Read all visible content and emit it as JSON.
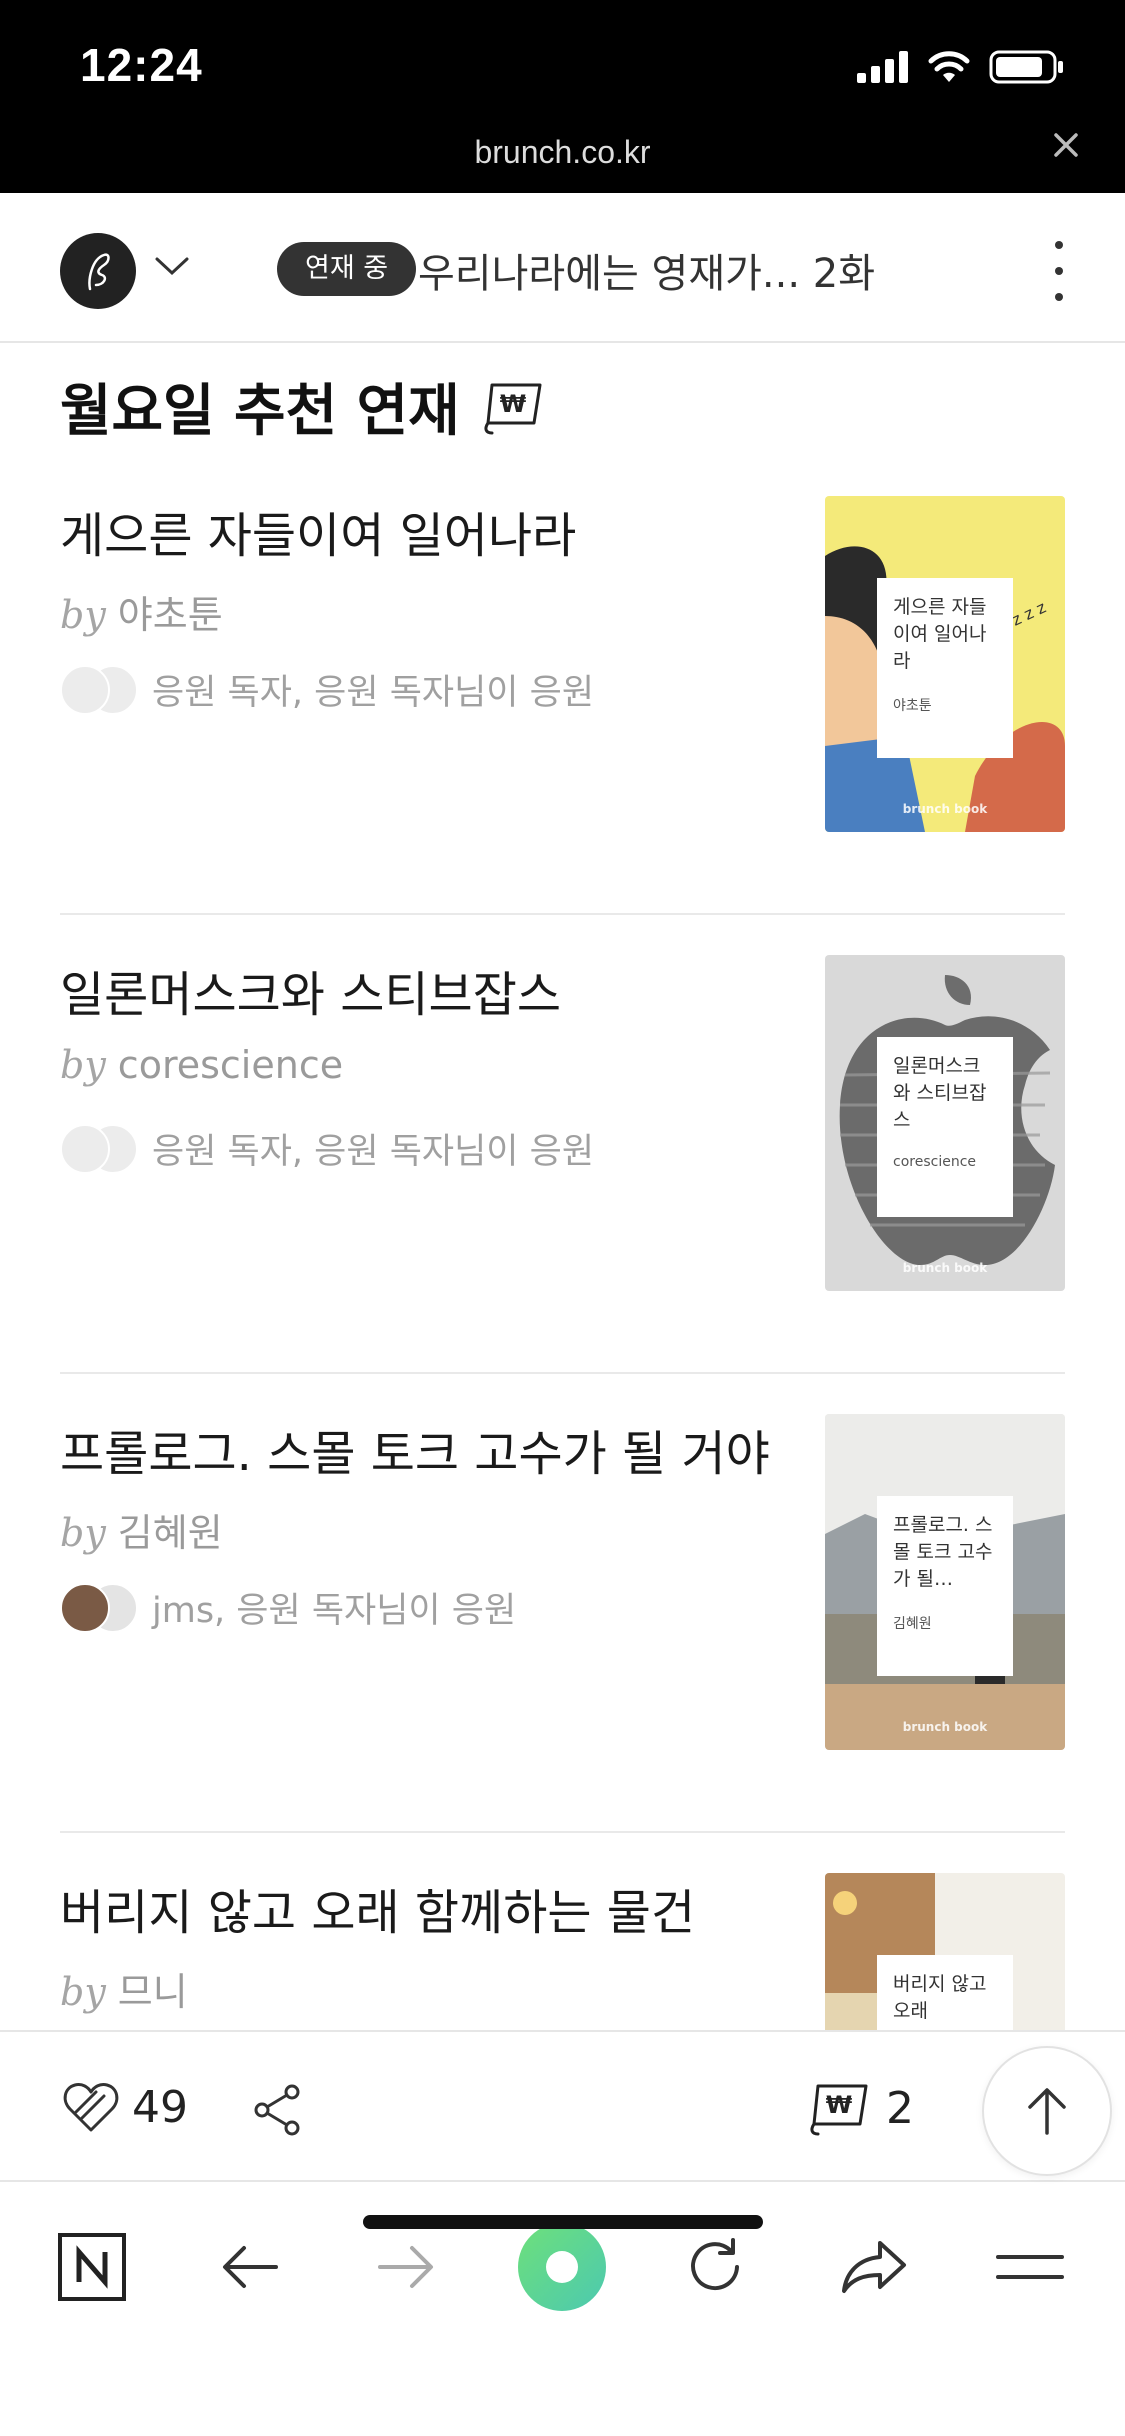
{
  "status_bar": {
    "time": "12:24",
    "url": "brunch.co.kr"
  },
  "topbar": {
    "badge": "연재 중",
    "series_title": "우리나라에는 영재가... 2화"
  },
  "section": {
    "title": "월요일 추천 연재"
  },
  "items": [
    {
      "title": "게으른 자들이여 일어나라",
      "by": "by",
      "author": "야초툰",
      "cheer": "응원 독자, 응원 독자님이 응원",
      "cover_title": "게으른 자들이여 일어나라",
      "cover_author": "야초툰",
      "cover_brand": "brunch book"
    },
    {
      "title": "일론머스크와 스티브잡스",
      "by": "by",
      "author": "corescience",
      "cheer": "응원 독자, 응원 독자님이 응원",
      "cover_title": "일론머스크와 스티브잡스",
      "cover_author": "corescience",
      "cover_brand": "brunch book"
    },
    {
      "title": "프롤로그. 스몰 토크 고수가 될 거야",
      "by": "by",
      "author": "김혜원",
      "cheer": "jms, 응원 독자님이 응원",
      "cover_title": "프롤로그. 스몰 토크 고수가 될…",
      "cover_author": "김혜원",
      "cover_brand": "brunch book"
    },
    {
      "title": "버리지 않고 오래 함께하는 물건",
      "by": "by",
      "author": "므니",
      "cover_title": "버리지 않고 오래"
    }
  ],
  "actionbar": {
    "likes": "49",
    "won_count": "2"
  },
  "colors": {
    "accent_green": "#5fd68a",
    "badge_bg": "#333333"
  },
  "icons": [
    "signal-icon",
    "wifi-icon",
    "battery-icon",
    "close-icon",
    "brunch-logo-icon",
    "chevron-down-icon",
    "more-icon",
    "won-icon",
    "heart-icon",
    "share-icon",
    "arrow-up-icon",
    "naver-n-icon",
    "back-icon",
    "forward-icon",
    "green-dot-icon",
    "refresh-icon",
    "share-arrow-icon",
    "menu-icon"
  ]
}
